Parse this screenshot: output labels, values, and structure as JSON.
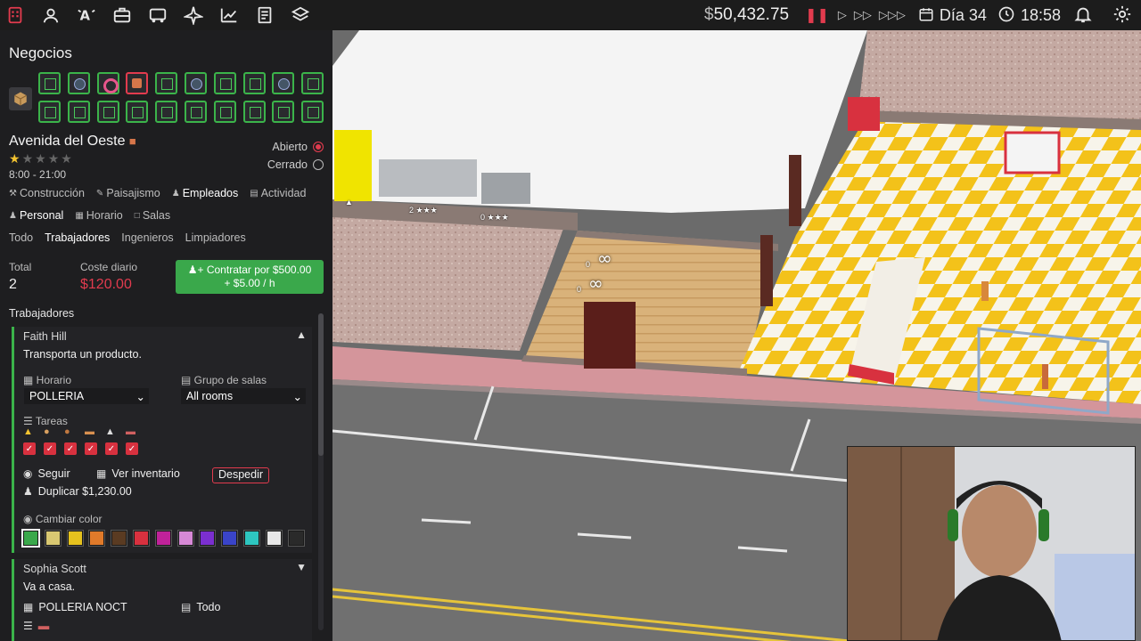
{
  "topbar": {
    "money": "50,432.75",
    "currency_symbol": "$",
    "day": "Día 34",
    "time": "18:58"
  },
  "panel": {
    "title": "Negocios",
    "store": {
      "name": "Avenida del Oeste",
      "rating": 1,
      "rating_max": 5,
      "hours": "8:00 - 21:00",
      "open_label": "Abierto",
      "closed_label": "Cerrado",
      "is_open": true
    },
    "main_tabs": [
      "Construcción",
      "Paisajismo",
      "Empleados",
      "Actividad"
    ],
    "active_main_tab": "Empleados",
    "sub_tabs": [
      "Personal",
      "Horario",
      "Salas"
    ],
    "filter_tabs": [
      "Todo",
      "Trabajadores",
      "Ingenieros",
      "Limpiadores"
    ],
    "active_filter": "Trabajadores",
    "total_label": "Total",
    "total_value": "2",
    "daily_cost_label": "Coste diario",
    "daily_cost_value": "$120.00",
    "hire_button_line1": "Contratar por $500.00",
    "hire_button_line2": "+ $5.00 / h",
    "workers_label": "Trabajadores",
    "workers": [
      {
        "name": "Faith Hill",
        "status": "Transporta un producto.",
        "schedule_label": "Horario",
        "schedule_value": "POLLERIA",
        "room_group_label": "Grupo de salas",
        "room_group_value": "All rooms",
        "tasks_label": "Tareas",
        "follow_label": "Seguir",
        "inventory_label": "Ver inventario",
        "fire_label": "Despedir",
        "duplicate_label": "Duplicar",
        "duplicate_price": "$1,230.00",
        "color_label": "Cambiar color",
        "colors": [
          "#3aa84b",
          "#d9c872",
          "#e6c21e",
          "#e07a2a",
          "#5a3b22",
          "#d8313f",
          "#c0229a",
          "#d789d6",
          "#7b2fd0",
          "#3a44c8",
          "#2ec6c0",
          "#e8e8e8",
          "#2a2a2a"
        ]
      },
      {
        "name": "Sophia Scott",
        "status": "Va a casa.",
        "schedule_value": "POLLERIA NOCT",
        "room_group_value": "Todo"
      }
    ]
  },
  "world": {
    "counters": [
      "0",
      "0",
      "2",
      "0"
    ]
  }
}
